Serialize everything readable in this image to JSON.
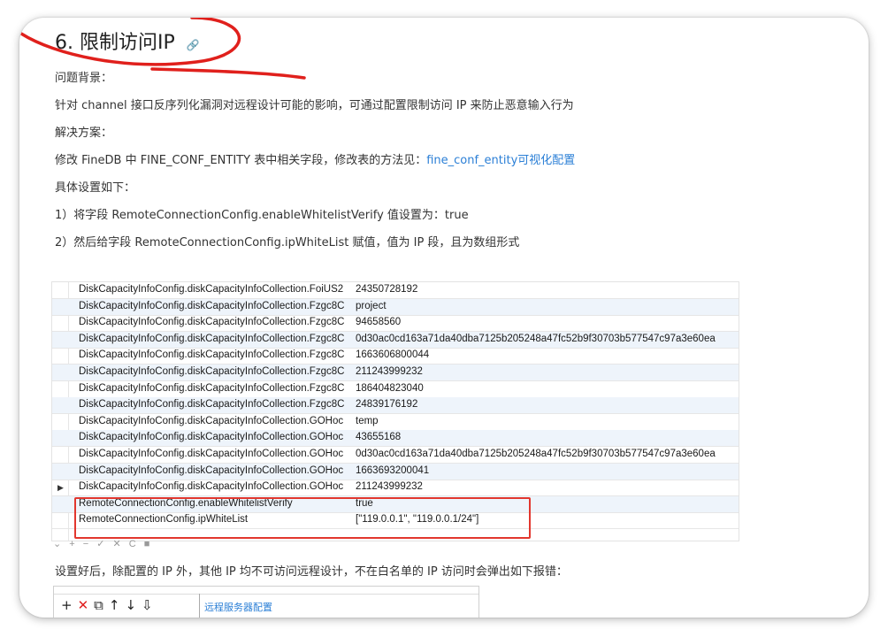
{
  "heading": {
    "title": "6. 限制访问IP",
    "anchor_icon": "link-icon"
  },
  "paragraphs": {
    "background_label": "问题背景：",
    "background_text": "针对 channel 接口反序列化漏洞对远程设计可能的影响，可通过配置限制访问 IP 来防止恶意输入行为",
    "solution_label": "解决方案：",
    "solution_text_pre": "修改 FineDB 中 FINE_CONF_ENTITY 表中相关字段，修改表的方法见：",
    "solution_link": "fine_conf_entity可视化配置",
    "settings_label": "具体设置如下：",
    "step1": "1）将字段 RemoteConnectionConfig.enableWhitelistVerify 值设置为：true",
    "step2": "2）然后给字段 RemoteConnectionConfig.ipWhiteList 赋值，值为 IP 段，且为数组形式",
    "after_text": "设置好后，除配置的 IP 外，其他 IP 均不可访问远程设计，不在白名单的 IP 访问时会弹出如下报错："
  },
  "table": {
    "rows": [
      {
        "key": "DiskCapacityInfoConfig.diskCapacityInfoCollection.FoiUS2",
        "value": "24350728192"
      },
      {
        "key": "DiskCapacityInfoConfig.diskCapacityInfoCollection.Fzgc8C",
        "value": "project"
      },
      {
        "key": "DiskCapacityInfoConfig.diskCapacityInfoCollection.Fzgc8C",
        "value": "94658560"
      },
      {
        "key": "DiskCapacityInfoConfig.diskCapacityInfoCollection.Fzgc8C",
        "value": "0d30ac0cd163a71da40dba7125b205248a47fc52b9f30703b577547c97a3e60ea"
      },
      {
        "key": "DiskCapacityInfoConfig.diskCapacityInfoCollection.Fzgc8C",
        "value": "1663606800044"
      },
      {
        "key": "DiskCapacityInfoConfig.diskCapacityInfoCollection.Fzgc8C",
        "value": "211243999232"
      },
      {
        "key": "DiskCapacityInfoConfig.diskCapacityInfoCollection.Fzgc8C",
        "value": "186404823040"
      },
      {
        "key": "DiskCapacityInfoConfig.diskCapacityInfoCollection.Fzgc8C",
        "value": "24839176192"
      },
      {
        "key": "DiskCapacityInfoConfig.diskCapacityInfoCollection.GOHoc",
        "value": "temp"
      },
      {
        "key": "DiskCapacityInfoConfig.diskCapacityInfoCollection.GOHoc",
        "value": "43655168"
      },
      {
        "key": "DiskCapacityInfoConfig.diskCapacityInfoCollection.GOHoc",
        "value": "0d30ac0cd163a71da40dba7125b205248a47fc52b9f30703b577547c97a3e60ea"
      },
      {
        "key": "DiskCapacityInfoConfig.diskCapacityInfoCollection.GOHoc",
        "value": "1663693200041"
      },
      {
        "key": "DiskCapacityInfoConfig.diskCapacityInfoCollection.GOHoc",
        "value": "211243999232"
      },
      {
        "key": "RemoteConnectionConfig.enableWhitelistVerify",
        "value": "true"
      },
      {
        "key": "RemoteConnectionConfig.ipWhiteList",
        "value": "[\"119.0.0.1\", \"119.0.0.1/24\"]"
      }
    ],
    "toolbar": "⌄ + − ✓ ✕ C ■"
  },
  "sub_dialog": {
    "toolbar_icons": [
      "+",
      "✕",
      "⧉",
      "↑",
      "↓",
      "⇩"
    ],
    "label": "远程服务器配置"
  }
}
